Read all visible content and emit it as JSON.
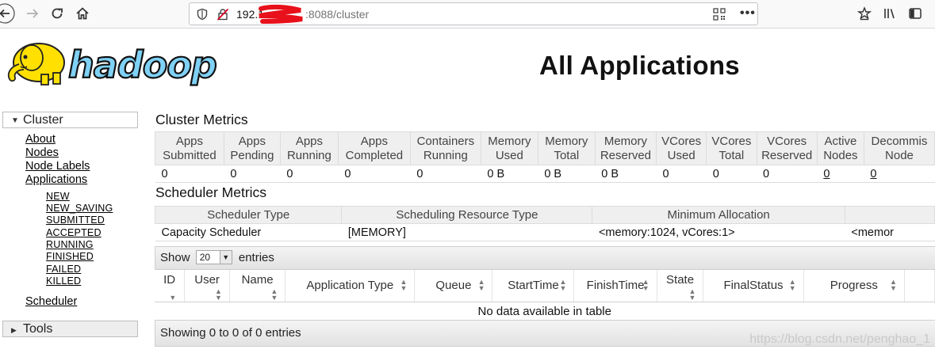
{
  "browser": {
    "url_host": "192.1",
    "url_rest": ":8088/cluster"
  },
  "header": {
    "logo_text": "hadoop",
    "title": "All Applications"
  },
  "sidebar": {
    "cluster_label": "Cluster",
    "links": [
      "About",
      "Nodes",
      "Node Labels",
      "Applications"
    ],
    "app_states": [
      "NEW",
      "NEW_SAVING",
      "SUBMITTED",
      "ACCEPTED",
      "RUNNING",
      "FINISHED",
      "FAILED",
      "KILLED"
    ],
    "scheduler_link": "Scheduler",
    "tools_label": "Tools"
  },
  "cluster_metrics": {
    "title": "Cluster Metrics",
    "headers": [
      [
        "Apps",
        "Submitted"
      ],
      [
        "Apps",
        "Pending"
      ],
      [
        "Apps",
        "Running"
      ],
      [
        "Apps",
        "Completed"
      ],
      [
        "Containers",
        "Running"
      ],
      [
        "Memory",
        "Used"
      ],
      [
        "Memory",
        "Total"
      ],
      [
        "Memory",
        "Reserved"
      ],
      [
        "VCores",
        "Used"
      ],
      [
        "VCores",
        "Total"
      ],
      [
        "VCores",
        "Reserved"
      ],
      [
        "Active",
        "Nodes"
      ],
      [
        "Decommis",
        "Node"
      ]
    ],
    "values": [
      "0",
      "0",
      "0",
      "0",
      "0",
      "0 B",
      "0 B",
      "0 B",
      "0",
      "0",
      "0",
      "0",
      "0"
    ]
  },
  "scheduler_metrics": {
    "title": "Scheduler Metrics",
    "headers": [
      "Scheduler Type",
      "Scheduling Resource Type",
      "Minimum Allocation",
      ""
    ],
    "values": [
      "Capacity Scheduler",
      "[MEMORY]",
      "<memory:1024, vCores:1>",
      "<memor"
    ]
  },
  "applications_table": {
    "show_label": "Show",
    "page_length": "20",
    "entries_label": "entries",
    "columns": [
      "ID",
      "User",
      "Name",
      "Application Type",
      "Queue",
      "StartTime",
      "FinishTime",
      "State",
      "FinalStatus",
      "Progress",
      ""
    ],
    "empty_message": "No data available in table",
    "info": "Showing 0 to 0 of 0 entries"
  },
  "watermark": "https://blog.csdn.net/penghao_1",
  "colors": {
    "logo_yellow": "#ffe000",
    "logo_blue": "#7fd1f5",
    "header_bg": "#efefef"
  }
}
